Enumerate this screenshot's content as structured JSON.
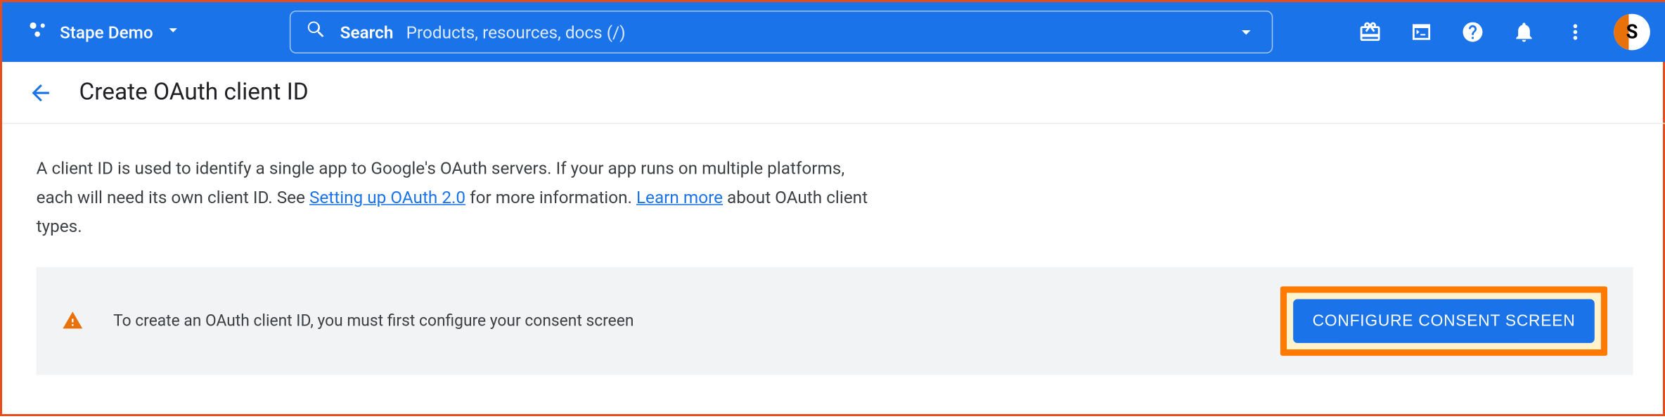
{
  "header": {
    "project_name": "Stape Demo",
    "search": {
      "label": "Search",
      "placeholder": "Products, resources, docs (/)"
    },
    "avatar_initial": "S"
  },
  "page": {
    "title": "Create OAuth client ID",
    "description_part1": "A client ID is used to identify a single app to Google's OAuth servers. If your app runs on multiple platforms, each will need its own client ID. See ",
    "link1_text": "Setting up OAuth 2.0",
    "description_part2": " for more information. ",
    "link2_text": "Learn more",
    "description_part3": " about OAuth client types."
  },
  "notice": {
    "text": "To create an OAuth client ID, you must first configure your consent screen",
    "button_label": "CONFIGURE CONSENT SCREEN"
  }
}
